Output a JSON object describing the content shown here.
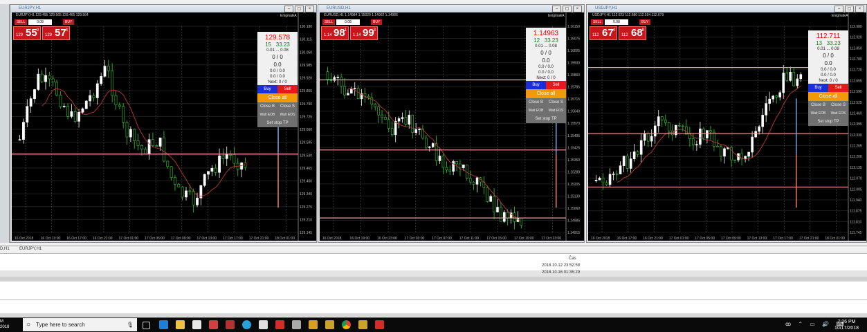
{
  "windows": [
    {
      "id": "eurjpy",
      "title": "EURJPY,H1",
      "info": "EURJPY,H1 129.495 129.565 129.465 129.564",
      "ea_name": "EnigmaEA",
      "lot": "0.08",
      "sell_label": "SELL",
      "buy_label": "BUY",
      "sell_small": "129",
      "sell_big": "55",
      "sell_sup": "9",
      "buy_small": "129",
      "buy_big": "57",
      "buy_sup": "4",
      "panel": {
        "price": "129.578",
        "spread": "15",
        "pips": "33.23",
        "lots": "0.01 ... 0.08",
        "count": "0 / 0",
        "profit": "0.0",
        "orders": "0.0 / 0.0",
        "orders2": "0.0 / 0.0",
        "next": "Next: 0 / 0",
        "buy": "Buy",
        "sell": "Sell",
        "close_all": "Close all",
        "close_b": "Close B",
        "close_s": "Close S",
        "wait_eob": "Wait EOB",
        "wait_eos": "Wait EOS",
        "set_stop_tp": "Set stop TP"
      },
      "y_ticks": [
        "130.180",
        "130.115",
        "130.050",
        "129.985",
        "129.920",
        "129.855",
        "129.790",
        "129.725",
        "129.660",
        "129.595",
        "129.530",
        "129.465",
        "129.400",
        "129.340",
        "129.275",
        "129.210",
        "129.145"
      ],
      "x_ticks": [
        "16 Oct 2018",
        "16 Oct 13:00",
        "16 Oct 17:00",
        "16 Oct 21:00",
        "17 Oct 01:00",
        "17 Oct 05:00",
        "17 Oct 09:00",
        "17 Oct 13:00",
        "17 Oct 17:00",
        "17 Oct 21:00",
        "18 Oct 01:00"
      ]
    },
    {
      "id": "eurusd",
      "title": "EURUSD,H1",
      "info": "EURUSD,H1 1.14984 1.15020 1.14962 1.14986",
      "ea_name": "EnigmaEA",
      "lot": "0.08",
      "sell_label": "SELL",
      "buy_label": "BUY",
      "sell_small": "1.14",
      "sell_big": "98",
      "sell_sup": "1",
      "buy_small": "1.14",
      "buy_big": "99",
      "buy_sup": "3",
      "panel": {
        "price": "1.14963",
        "spread": "12",
        "pips": "33.23",
        "lots": "0.01 ... 0.08",
        "count": "0 / 0",
        "profit": "0.0",
        "orders": "0.0 / 0.0",
        "orders2": "0.0 / 0.0",
        "next": "Next: 0 / 0",
        "buy": "Buy",
        "sell": "Sell",
        "close_all": "Close all",
        "close_b": "Close B",
        "close_s": "Close S",
        "wait_eob": "Wait EOB",
        "wait_eos": "Wait EOS",
        "set_stop_tp": "Set stop TP"
      },
      "y_ticks": [
        "1.16150",
        "1.16075",
        "1.16005",
        "1.15930",
        "1.15860",
        "1.15785",
        "1.15715",
        "1.15640",
        "1.15570",
        "1.15495",
        "1.15425",
        "1.15350",
        "1.15280",
        "1.15205",
        "1.15130",
        "1.15060",
        "1.14985",
        "1.14915"
      ],
      "x_ticks": [
        "16 Oct 2018",
        "16 Oct 19:00",
        "16 Oct 23:00",
        "17 Oct 03:00",
        "17 Oct 07:00",
        "17 Oct 11:00",
        "17 Oct 15:00",
        "17 Oct 19:00",
        "17 Oct 23:00"
      ]
    },
    {
      "id": "usdjpy",
      "title": "USDJPY,H1",
      "info": "USDJPY,H1 112.623 112.680 112.594 112.679",
      "ea_name": "EnigmaEA",
      "lot": "0.08",
      "sell_label": "SELL",
      "buy_label": "BUY",
      "sell_small": "112",
      "sell_big": "67",
      "sell_sup": "4",
      "buy_small": "112",
      "buy_big": "68",
      "buy_sup": "8",
      "panel": {
        "price": "112.711",
        "spread": "13",
        "pips": "33.23",
        "lots": "0.01 ... 0.08",
        "count": "0 / 0",
        "profit": "0.0",
        "orders": "0.0 / 0.0",
        "orders2": "0.0 / 0.0",
        "next": "Next: 0 / 0",
        "buy": "Buy",
        "sell": "Sell",
        "close_all": "Close all",
        "close_b": "Close B",
        "close_s": "Close S",
        "wait_eob": "Wait EOB",
        "wait_eos": "Wait EOS",
        "set_stop_tp": "Set stop TP"
      },
      "y_ticks": [
        "112.980",
        "112.920",
        "112.850",
        "112.780",
        "112.720",
        "112.655",
        "112.590",
        "112.525",
        "112.460",
        "112.395",
        "112.330",
        "112.265",
        "112.200",
        "112.135",
        "112.070",
        "112.005",
        "111.940",
        "111.875",
        "111.810",
        "111.745"
      ],
      "x_ticks": [
        "16 Oct 2018",
        "16 Oct 17:00",
        "16 Oct 21:00",
        "17 Oct 01:00",
        "17 Oct 05:00",
        "17 Oct 09:00",
        "17 Oct 13:00",
        "17 Oct 17:00",
        "17 Oct 21:00",
        "18 Oct 01:00"
      ]
    }
  ],
  "bottom_tabs": [
    "D,H1",
    "EURJPY,H1"
  ],
  "terminal": {
    "col_header": "Čas",
    "rows": [
      "2018.10.12 23:52:58",
      "2018.10.16 01:35:29"
    ]
  },
  "taskbar": {
    "search_placeholder": "Type here to search",
    "time": "7:26 PM",
    "date": "10/17/2018",
    "left_label_top": "M",
    "left_label_bottom": "2018"
  },
  "colors": {
    "chart_bg": "#000000",
    "bull_candle": "#ffffff",
    "bear_candle": "#32cd32",
    "ma_line": "#c0392b",
    "level_line": "#ff9aa2",
    "sell_red": "#c8161c"
  }
}
